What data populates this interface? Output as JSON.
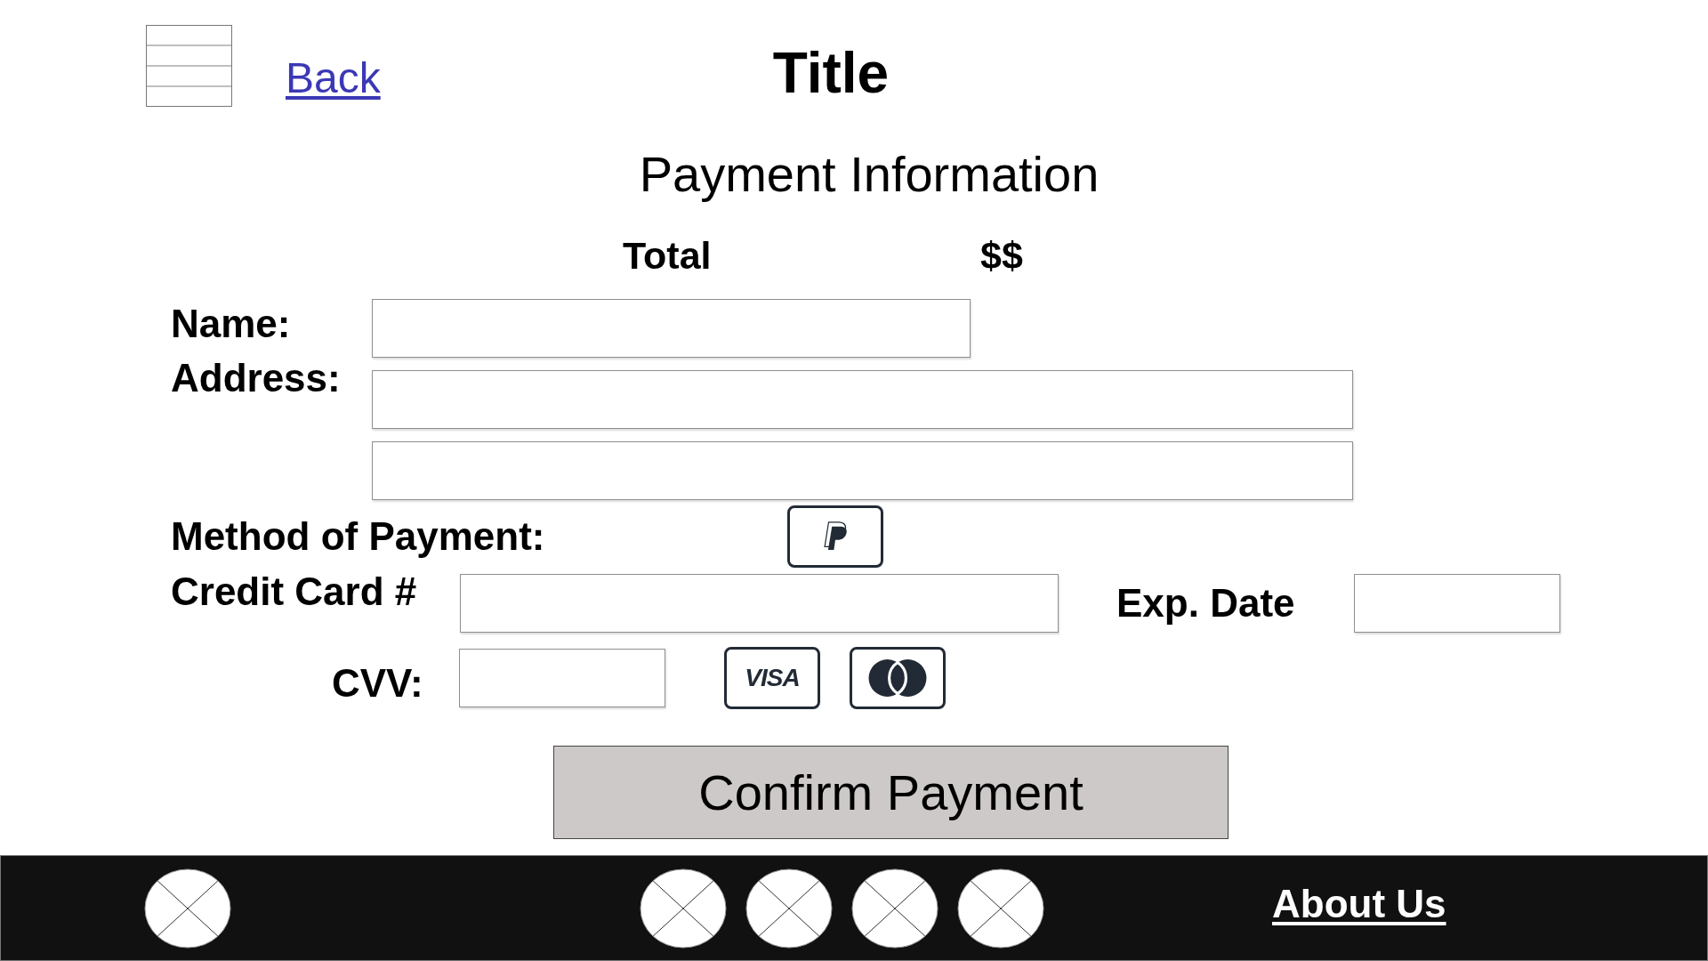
{
  "header": {
    "back_link": "Back",
    "title": "Title"
  },
  "payment": {
    "heading": "Payment Information",
    "total": {
      "label": "Total",
      "value": "$$"
    },
    "name": {
      "label": "Name:"
    },
    "address": {
      "label": "Address:"
    },
    "method": {
      "label": "Method of Payment:",
      "options": [
        {
          "kind": "paypal"
        }
      ]
    },
    "credit_card": {
      "label": "Credit Card #"
    },
    "expiry": {
      "label": "Exp. Date"
    },
    "cvv": {
      "label": "CVV:",
      "card_logos": [
        {
          "kind": "visa",
          "label": "VISA"
        },
        {
          "kind": "mastercard"
        }
      ]
    },
    "confirm_button": "Confirm Payment"
  },
  "footer": {
    "link": "About Us"
  }
}
